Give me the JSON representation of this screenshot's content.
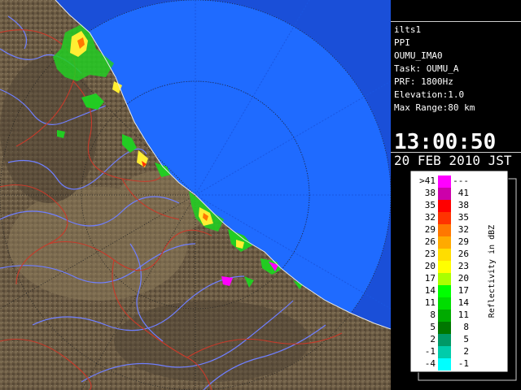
{
  "info": {
    "lines": [
      "ilts1",
      "PPI",
      "OUMU_IMA0",
      "Task: OUMU_A",
      "PRF: 1800Hz",
      "Elevation:1.0",
      "Max Range:80 km"
    ],
    "time": "13:00:50",
    "date": "20 FEB 2010 JST"
  },
  "legend": {
    "title": "Reflectivity in dBZ",
    "rows": [
      {
        "left": ">41",
        "right": "---",
        "color": "#ff00ff"
      },
      {
        "left": "38",
        "right": "41",
        "color": "#cc00aa"
      },
      {
        "left": "35",
        "right": "38",
        "color": "#ff0000"
      },
      {
        "left": "32",
        "right": "35",
        "color": "#ff3300"
      },
      {
        "left": "29",
        "right": "32",
        "color": "#ff7700"
      },
      {
        "left": "26",
        "right": "29",
        "color": "#ffaa00"
      },
      {
        "left": "23",
        "right": "26",
        "color": "#ffdd00"
      },
      {
        "left": "20",
        "right": "23",
        "color": "#ffff00"
      },
      {
        "left": "17",
        "right": "20",
        "color": "#aaff00"
      },
      {
        "left": "14",
        "right": "17",
        "color": "#00ff00"
      },
      {
        "left": "11",
        "right": "14",
        "color": "#00dd00"
      },
      {
        "left": "8",
        "right": "11",
        "color": "#00aa00"
      },
      {
        "left": "5",
        "right": "8",
        "color": "#007700"
      },
      {
        "left": "2",
        "right": "5",
        "color": "#009966"
      },
      {
        "left": "-1",
        "right": "2",
        "color": "#00ccaa"
      },
      {
        "left": "-4",
        "right": "-1",
        "color": "#00ffff"
      }
    ]
  },
  "colors": {
    "terrain": "#6b5a43",
    "sea": "#1f6bff",
    "outer_range": "#1a4fd8",
    "rivers": "#6f7fff",
    "boundaries": "#c83a2a",
    "echo_green": "#22cc22",
    "echo_yellow": "#ffee33"
  }
}
